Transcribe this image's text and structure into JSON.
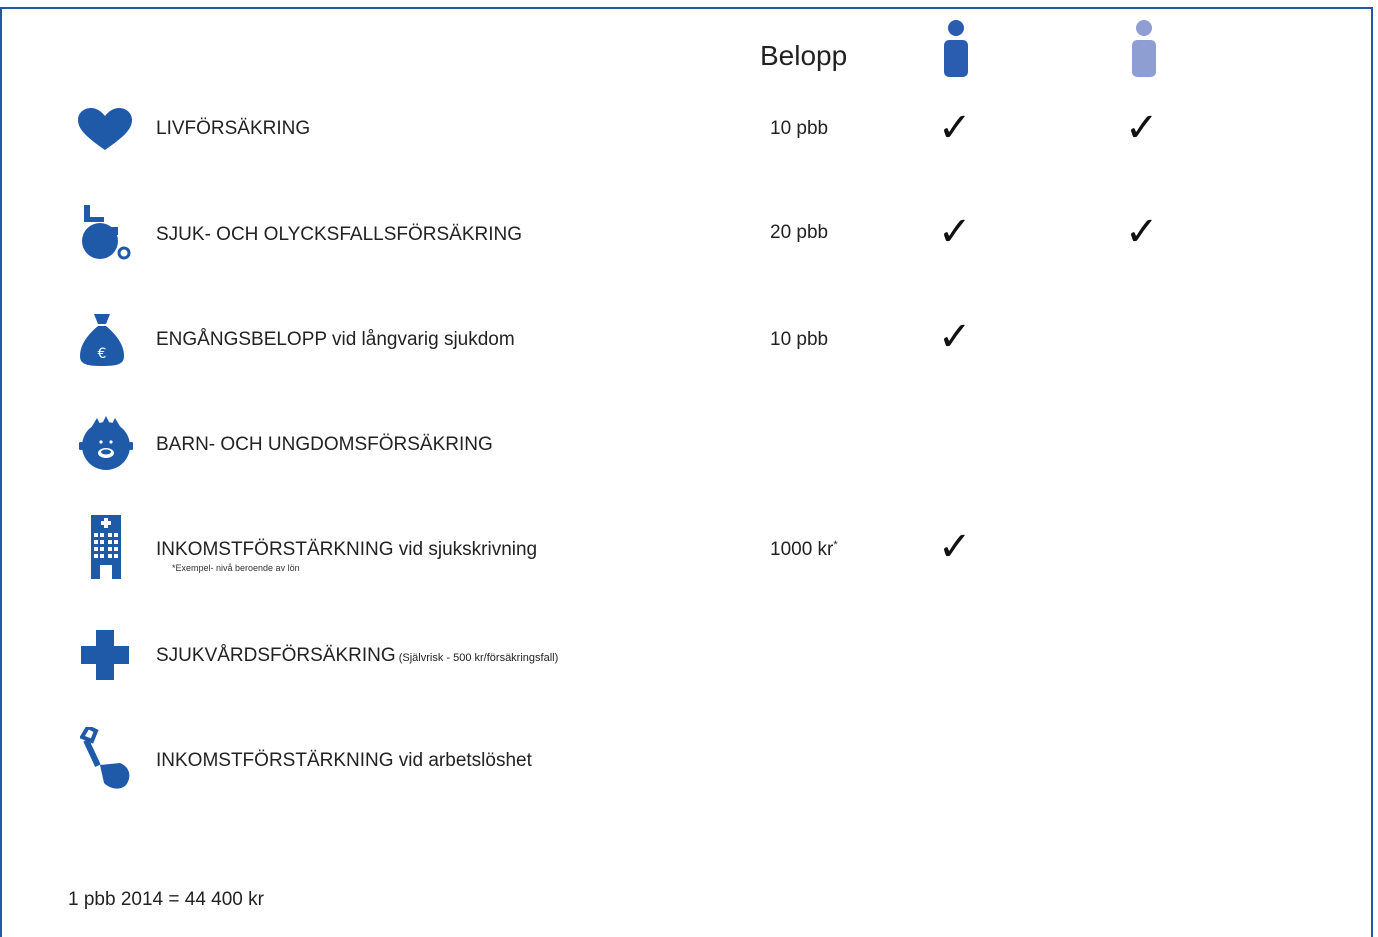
{
  "header": {
    "amount_label": "Belopp"
  },
  "columns": [
    {
      "name": "person-dark-icon",
      "color": "#2a5db0"
    },
    {
      "name": "person-light-icon",
      "color": "#8e9ed3"
    }
  ],
  "rows": [
    {
      "icon": "heart-icon",
      "label": "LIVFÖRSÄKRING",
      "label_small": "",
      "note": "",
      "amount": "10 pbb",
      "amount_star": "",
      "check1": "✓",
      "check2": "✓"
    },
    {
      "icon": "wheelchair-icon",
      "label": "SJUK- OCH OLYCKSFALLSFÖRSÄKRING",
      "label_small": "",
      "note": "",
      "amount": "20 pbb",
      "amount_star": "",
      "check1": "✓",
      "check2": "✓"
    },
    {
      "icon": "money-bag-icon",
      "label": "ENGÅNGSBELOPP vid långvarig sjukdom",
      "label_small": "",
      "note": "",
      "amount": "10 pbb",
      "amount_star": "",
      "check1": "✓",
      "check2": ""
    },
    {
      "icon": "child-face-icon",
      "label": "BARN- OCH UNGDOMSFÖRSÄKRING",
      "label_small": "",
      "note": "",
      "amount": "",
      "amount_star": "",
      "check1": "",
      "check2": ""
    },
    {
      "icon": "hospital-building-icon",
      "label": "INKOMSTFÖRSTÄRKNING vid sjukskrivning",
      "label_small": "",
      "note": "*Exempel- nivå beroende av lön",
      "amount": "1000 kr",
      "amount_star": "*",
      "check1": "✓",
      "check2": ""
    },
    {
      "icon": "medical-cross-icon",
      "label": "SJUKVÅRDSFÖRSÄKRING",
      "label_small": " (Självrisk - 500 kr/försäkringsfall)",
      "note": "",
      "amount": "",
      "amount_star": "",
      "check1": "",
      "check2": ""
    },
    {
      "icon": "shovel-icon",
      "label": "INKOMSTFÖRSTÄRKNING vid arbetslöshet",
      "label_small": "",
      "note": "",
      "amount": "",
      "amount_star": "",
      "check1": "",
      "check2": ""
    }
  ],
  "footer": {
    "note": "1 pbb 2014 = 44 400 kr"
  },
  "colors": {
    "brand": "#1f5aa8",
    "person_dark": "#2a5db0",
    "person_light": "#8e9ed3"
  }
}
